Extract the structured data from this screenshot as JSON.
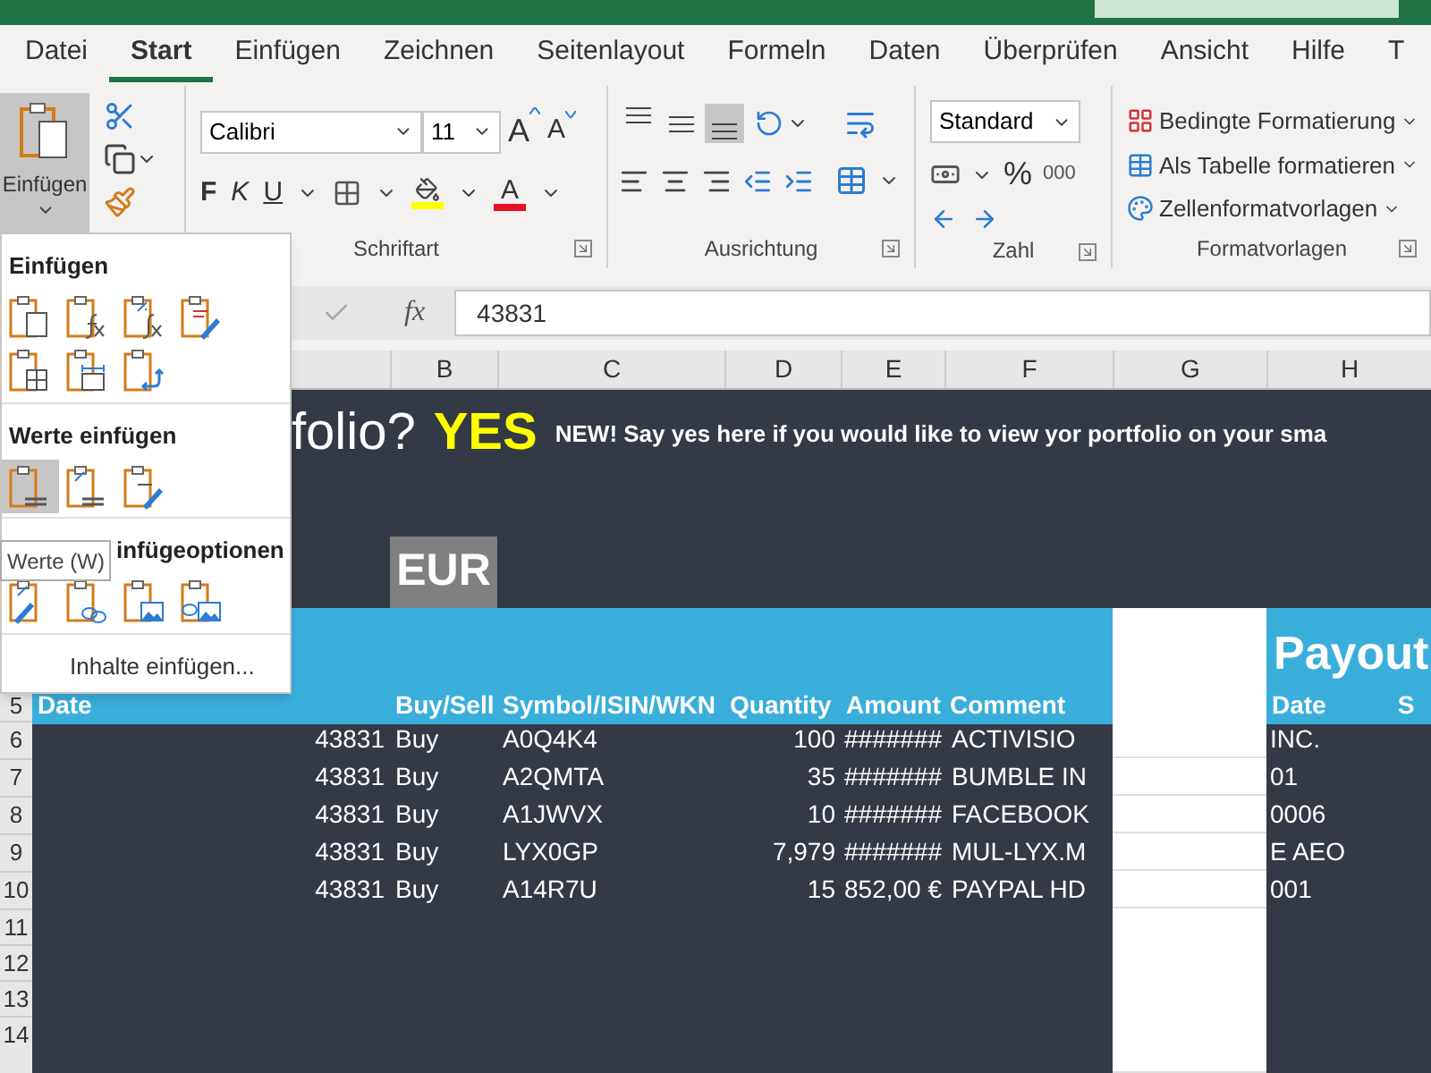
{
  "tabs": [
    {
      "label": "Datei",
      "selected": false
    },
    {
      "label": "Start",
      "selected": true
    },
    {
      "label": "Einfügen",
      "selected": false
    },
    {
      "label": "Zeichnen",
      "selected": false
    },
    {
      "label": "Seitenlayout",
      "selected": false
    },
    {
      "label": "Formeln",
      "selected": false
    },
    {
      "label": "Daten",
      "selected": false
    },
    {
      "label": "Überprüfen",
      "selected": false
    },
    {
      "label": "Ansicht",
      "selected": false
    },
    {
      "label": "Hilfe",
      "selected": false
    },
    {
      "label": "T",
      "selected": false
    }
  ],
  "ribbon": {
    "paste_label": "Einfügen",
    "paste_expanded": true,
    "font": {
      "name": "Calibri",
      "size": "11",
      "grow": "A",
      "shrink": "A",
      "bold": "F",
      "italic": "K",
      "underline": "U",
      "font_color": "A",
      "group_label": "Schriftart"
    },
    "alignment": {
      "vertical": [
        {
          "kind": "top",
          "selected": false
        },
        {
          "kind": "middle",
          "selected": false
        },
        {
          "kind": "bottom",
          "selected": true
        }
      ],
      "group_label": "Ausrichtung"
    },
    "number": {
      "format": "Standard",
      "percent": "%",
      "thousands": "000",
      "group_label": "Zahl"
    },
    "styles": {
      "items": [
        "Bedingte Formatierung",
        "Als Tabelle formatieren",
        "Zellenformatvorlagen"
      ],
      "group_label": "Formatvorlagen"
    }
  },
  "formula_bar": {
    "function_label": "fx",
    "value": "43831"
  },
  "columns": [
    "B",
    "C",
    "D",
    "E",
    "F",
    "G",
    "H"
  ],
  "sheet": {
    "title": "folio?",
    "answer": "YES",
    "note": "NEW! Say yes here if you would like to view yor portfolio on your sma",
    "currency": "EUR",
    "payout_title": "Payout",
    "header_row": "5",
    "headers": [
      "Date",
      "Buy/Sell",
      "Symbol/ISIN/WKN",
      "Quantity",
      "Amount",
      "Comment",
      "Date",
      "S"
    ],
    "rows": [
      {
        "row": "6",
        "date": "43831",
        "type": "Buy",
        "symbol": "A0Q4K4",
        "quantity": "100",
        "amount": "#######",
        "comment": "ACTIVISIO",
        "overflow": "INC."
      },
      {
        "row": "7",
        "date": "43831",
        "type": "Buy",
        "symbol": "A2QMTA",
        "quantity": "35",
        "amount": "#######",
        "comment": "BUMBLE IN",
        "overflow": "01"
      },
      {
        "row": "8",
        "date": "43831",
        "type": "Buy",
        "symbol": "A1JWVX",
        "quantity": "10",
        "amount": "#######",
        "comment": "FACEBOOK",
        "overflow": "0006"
      },
      {
        "row": "9",
        "date": "43831",
        "type": "Buy",
        "symbol": "LYX0GP",
        "quantity": "7,979",
        "amount": "#######",
        "comment": "MUL-LYX.M",
        "overflow": "E AEO"
      },
      {
        "row": "10",
        "date": "43831",
        "type": "Buy",
        "symbol": "A14R7U",
        "quantity": "15",
        "amount": "852,00 €",
        "comment": "PAYPAL HD",
        "overflow": "001"
      }
    ],
    "empty_rows": [
      "11",
      "12",
      "13",
      "14"
    ]
  },
  "paste_menu": {
    "sections": [
      {
        "heading": "Einfügen",
        "options": [
          {
            "kind": "all",
            "selected": false
          },
          {
            "kind": "formulas",
            "selected": false
          },
          {
            "kind": "formulas-number",
            "selected": false
          },
          {
            "kind": "source-format",
            "selected": false
          },
          {
            "kind": "no-borders",
            "selected": false
          },
          {
            "kind": "column-widths",
            "selected": false
          },
          {
            "kind": "transpose",
            "selected": false
          }
        ]
      },
      {
        "heading": "Werte einfügen",
        "options": [
          {
            "kind": "values",
            "selected": true
          },
          {
            "kind": "values-number",
            "selected": false
          },
          {
            "kind": "values-source",
            "selected": false
          }
        ]
      },
      {
        "heading": "infügeoptionen",
        "options": [
          {
            "kind": "formatting",
            "selected": false
          },
          {
            "kind": "link",
            "selected": false
          },
          {
            "kind": "picture",
            "selected": false
          },
          {
            "kind": "linked-picture",
            "selected": false
          }
        ]
      }
    ],
    "special": "Inhalte einfügen...",
    "tooltip": "Werte (W)"
  }
}
